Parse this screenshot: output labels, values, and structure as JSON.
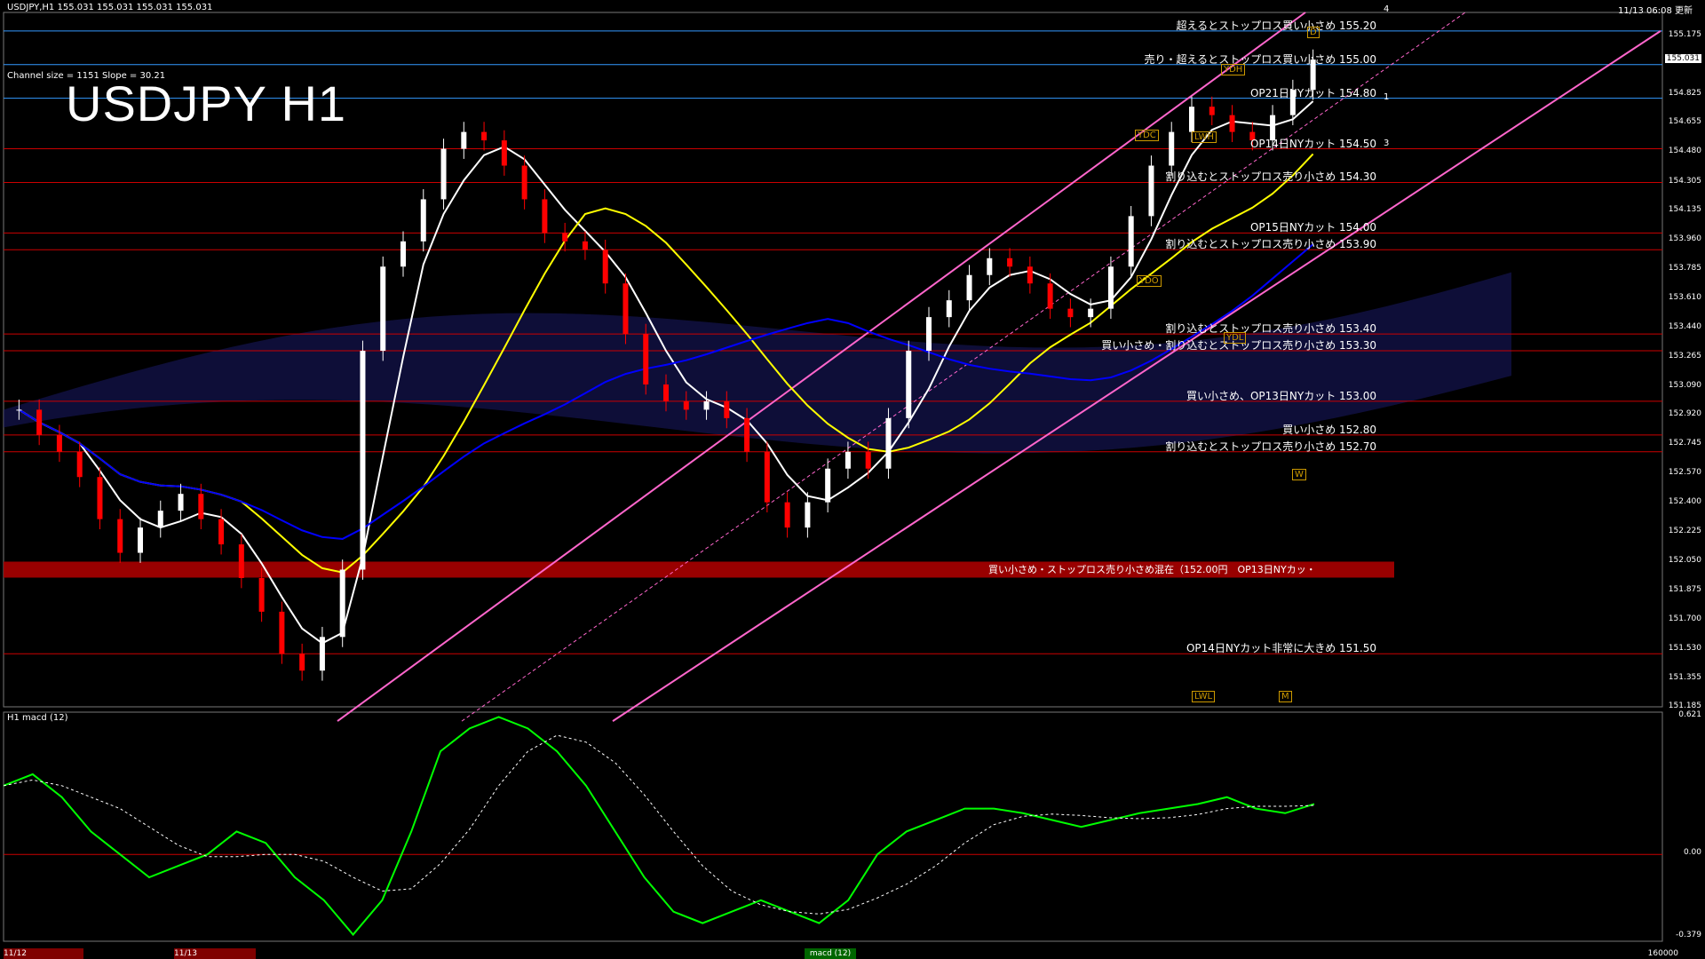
{
  "header": {
    "symbol_line": "USDJPY,H1  155.031 155.031 155.031 155.031",
    "datetime": "11/13 06:08 更新",
    "channel_info": "Channel size = 1151 Slope = 30.21"
  },
  "title": "USDJPY H1",
  "colors": {
    "background": "#000000",
    "up_candle": "#ffffff",
    "down_candle": "#ff0000",
    "channel_line": "#ff66cc",
    "ma_white": "#ffffff",
    "ma_yellow": "#ffff00",
    "ma_blue": "#0000ff",
    "ichimoku_green": "#00cc00",
    "macd_main": "#00ff00",
    "macd_signal": "#ffffff",
    "level_red": "#cc0000",
    "level_blue": "#3399ff",
    "band_red": "#990000"
  },
  "price_levels": [
    {
      "label": "超えるとストップロス買い小さめ 155.20",
      "price": 155.2,
      "color": "#3399ff"
    },
    {
      "label": "売り・超えるとストップロス買い小さめ 155.00",
      "price": 155.0,
      "color": "#3399ff"
    },
    {
      "label": "OP21日NYカット 154.80",
      "price": 154.8,
      "color": "#3399ff"
    },
    {
      "label": "OP14日NYカット 154.50",
      "price": 154.5,
      "color": "#cc0000"
    },
    {
      "label": "割り込むとストップロス売り小さめ 154.30",
      "price": 154.3,
      "color": "#cc0000"
    },
    {
      "label": "OP15日NYカット 154.00",
      "price": 154.0,
      "color": "#cc0000"
    },
    {
      "label": "割り込むとストップロス売り小さめ 153.90",
      "price": 153.9,
      "color": "#cc0000"
    },
    {
      "label": "割り込むとストップロス売り小さめ 153.40",
      "price": 153.4,
      "color": "#cc0000"
    },
    {
      "label": "買い小さめ・割り込むとストップロス売り小さめ 153.30",
      "price": 153.3,
      "color": "#cc0000"
    },
    {
      "label": "買い小さめ、OP13日NYカット 153.00",
      "price": 153.0,
      "color": "#cc0000"
    },
    {
      "label": "買い小さめ 152.80",
      "price": 152.8,
      "color": "#cc0000"
    },
    {
      "label": "割り込むとストップロス売り小さめ 152.70",
      "price": 152.7,
      "color": "#cc0000"
    },
    {
      "label": "OP14日NYカット非常に大きめ 151.50",
      "price": 151.5,
      "color": "#cc0000"
    }
  ],
  "band": {
    "label": "買い小さめ・ストップロス売り小さめ混在（152.00円　OP13日NYカッ・",
    "price": 152.0
  },
  "markers": [
    "YDH",
    "YDC",
    "YDO",
    "YDL",
    "LWH",
    "LWL",
    "W",
    "D",
    "M"
  ],
  "channel_labels": [
    "4",
    "1",
    "3"
  ],
  "price_axis": [
    "155.175",
    "155.031",
    "154.825",
    "154.655",
    "154.480",
    "154.305",
    "154.135",
    "153.960",
    "153.785",
    "153.610",
    "153.440",
    "153.265",
    "153.090",
    "152.920",
    "152.745",
    "152.570",
    "152.400",
    "152.225",
    "152.050",
    "151.875",
    "151.700",
    "151.530",
    "151.355",
    "151.185"
  ],
  "current_price": "155.031",
  "macd_panel": {
    "label": "H1  macd (12)",
    "axis": [
      "0.621",
      "0.00",
      "-0.379"
    ]
  },
  "bottom_axis": {
    "left": "11/12",
    "mid": "11/13",
    "tab": "macd (12)",
    "right": "160000"
  },
  "chart_data": {
    "type": "line",
    "title": "USDJPY H1",
    "ylim": [
      151.185,
      155.31
    ],
    "series": [
      {
        "values": [
          152.95,
          152.8,
          152.7,
          152.55,
          152.3,
          152.1,
          152.25,
          152.35,
          152.45,
          152.3,
          152.15,
          151.95,
          151.75,
          151.5,
          151.4,
          151.6,
          152.0,
          153.3,
          153.8,
          153.95,
          154.2,
          154.5,
          154.6,
          154.55,
          154.4,
          154.2,
          154.0,
          153.95,
          153.9,
          153.7,
          153.4,
          153.1,
          153.0,
          152.95,
          153.0,
          152.9,
          152.7,
          152.4,
          152.25,
          152.4,
          152.6,
          152.7,
          152.6,
          152.9,
          153.3,
          153.5,
          153.6,
          153.75,
          153.85,
          153.8,
          153.7,
          153.55,
          153.5,
          153.55,
          153.8,
          154.1,
          154.4,
          154.6,
          154.75,
          154.7,
          154.6,
          154.55,
          154.7,
          154.85,
          155.03
        ]
      }
    ],
    "macd": [
      0.3,
      0.35,
      0.25,
      0.1,
      0.0,
      -0.1,
      -0.05,
      0.0,
      0.1,
      0.05,
      -0.1,
      -0.2,
      -0.35,
      -0.2,
      0.1,
      0.45,
      0.55,
      0.6,
      0.55,
      0.45,
      0.3,
      0.1,
      -0.1,
      -0.25,
      -0.3,
      -0.25,
      -0.2,
      -0.25,
      -0.3,
      -0.2,
      0.0,
      0.1,
      0.15,
      0.2,
      0.2,
      0.18,
      0.15,
      0.12,
      0.15,
      0.18,
      0.2,
      0.22,
      0.25,
      0.2,
      0.18,
      0.22
    ]
  }
}
